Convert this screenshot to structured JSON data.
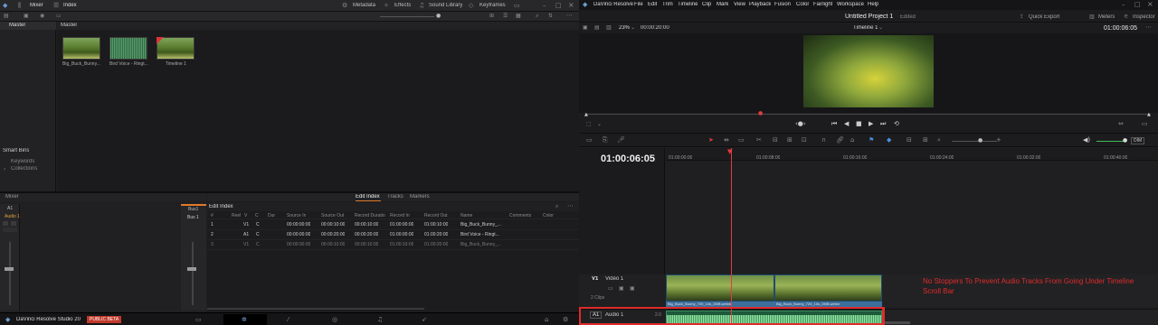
{
  "left": {
    "toolbar": {
      "mixer": "Mixer",
      "index": "Index",
      "metadata": "Metadata",
      "effects": "Effects",
      "sound_library": "Sound Library",
      "keyframes": "Keyframes"
    },
    "pool": {
      "master_label": "Master",
      "master_header": "Master",
      "smart_bins": "Smart Bins",
      "keywords": "Keywords",
      "collections": "Collections",
      "clips": [
        {
          "label": "Big_Buck_Bunny..."
        },
        {
          "label": "Bird Voice - Ringt..."
        },
        {
          "label": "Timeline 1"
        }
      ]
    },
    "mixer": {
      "title": "Mixer",
      "a1": "A1",
      "audio1": "Audio 1",
      "bus1_a": "Bus1",
      "bus1_b": "Bus 1"
    },
    "edit_index": {
      "tab_edit_index": "Edit Index",
      "tab_tracks": "Tracks",
      "tab_markers": "Markers",
      "title": "Edit Index",
      "columns": [
        "#",
        "Reel",
        "V",
        "C",
        "Dur",
        "Source In",
        "Source Out",
        "Record Duratio",
        "Record In",
        "Record Out",
        "Name",
        "Comments",
        "Color"
      ],
      "rows": [
        {
          "n": "1",
          "v": "V1",
          "c": "C",
          "src_in": "00:00:00:00",
          "src_out": "00:00:10:00",
          "rec_dur": "00:00:10:00",
          "rec_in": "01:00:00:00",
          "rec_out": "01:00:10:00",
          "name": "Big_Buck_Bunny_..."
        },
        {
          "n": "2",
          "v": "A1",
          "c": "C",
          "src_in": "00:00:00:00",
          "src_out": "00:00:20:00",
          "rec_dur": "00:00:20:00",
          "rec_in": "01:00:00:00",
          "rec_out": "01:00:20:00",
          "name": "Bird Voice - Ringt..."
        },
        {
          "n": "3",
          "v": "V1",
          "c": "C",
          "src_in": "00:00:00:00",
          "src_out": "00:00:10:00",
          "rec_dur": "00:00:10:00",
          "rec_in": "01:00:10:00",
          "rec_out": "01:00:20:00",
          "name": "Big_Buck_Bunny_..."
        }
      ]
    },
    "bottom": {
      "app_name": "DaVinci Resolve Studio 20",
      "badge": "PUBLIC BETA"
    }
  },
  "right": {
    "menu": {
      "app": "DaVinci Resolve",
      "items": [
        "File",
        "Edit",
        "Trim",
        "Timeline",
        "Clip",
        "Mark",
        "View",
        "Playback",
        "Fusion",
        "Color",
        "Fairlight",
        "Workspace",
        "Help"
      ]
    },
    "project": {
      "title": "Untitled Project 1",
      "status": "Edited",
      "quick_export": "Quick Export",
      "meters": "Meters",
      "inspector": "Inspector"
    },
    "viewer": {
      "zoom": "23%",
      "source_tc": "00:00:20:00",
      "timeline_name": "Timeline 1",
      "tc": "01:00:06:05"
    },
    "timeline": {
      "timecode": "01:00:06:05",
      "ruler": [
        "01:00:00:00",
        "01:00:08:00",
        "01:00:16:00",
        "01:00:24:00",
        "01:00:32:00",
        "01:00:40:00"
      ],
      "playhead_fraction": 0.185,
      "v1": {
        "label": "V1",
        "name": "Video 1",
        "clips": "2 Clips"
      },
      "a1": {
        "label": "A1",
        "name": "Audio 1",
        "level": "2.0"
      },
      "clip_labels": [
        "Big_Buck_Bunny_720_10s_2MB.webm",
        "Big_Buck_Bunny_720_10s_2MB.webm"
      ],
      "om": "DIM"
    },
    "annotation": "No Stoppers To Prevent Audio Tracks From Going Under Timeline Scroll Bar"
  },
  "colors": {
    "accent_orange": "#e07a2a",
    "playhead_red": "#e33c3c",
    "annotation_red": "#e02a2a",
    "clip_blue": "#3d6e9c",
    "audio_green": "#3b8d5e"
  }
}
